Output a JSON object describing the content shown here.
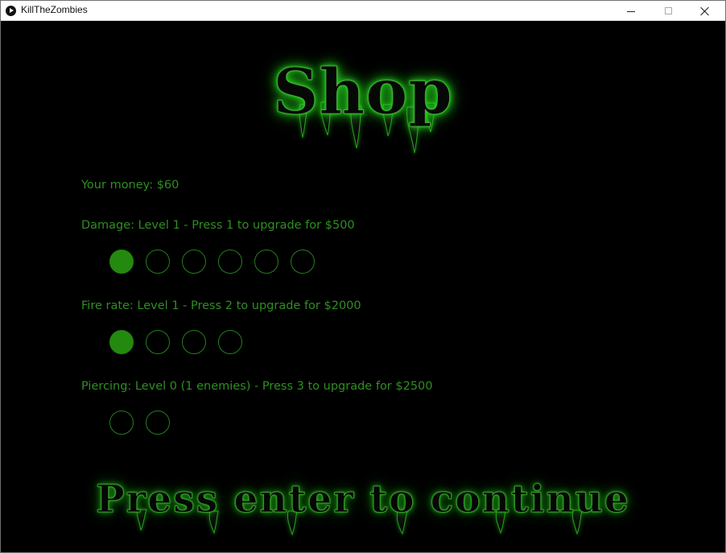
{
  "window": {
    "title": "KillTheZombies",
    "icon": "play-icon",
    "controls": {
      "minimize_icon": "minimize-icon",
      "maximize_icon": "maximize-icon",
      "close_icon": "close-icon"
    }
  },
  "shop": {
    "title": "Shop",
    "money": "Your money: $60",
    "upgrades": {
      "damage": {
        "label": "Damage: Level 1 - Press 1 to upgrade for $500",
        "current_level": 1,
        "max_level": 6
      },
      "fire_rate": {
        "label": "Fire rate: Level 1 - Press 2 to upgrade for $2000",
        "current_level": 1,
        "max_level": 4
      },
      "piercing": {
        "label": "Piercing: Level 0 (1 enemies) - Press 3 to upgrade for $2500",
        "current_level": 0,
        "max_level": 2
      }
    },
    "continue": "Press enter to continue"
  },
  "colors": {
    "background": "#000000",
    "text_green": "#2e8f21",
    "filled_level": "#238a0f",
    "glow_green": "#2cff1f"
  }
}
